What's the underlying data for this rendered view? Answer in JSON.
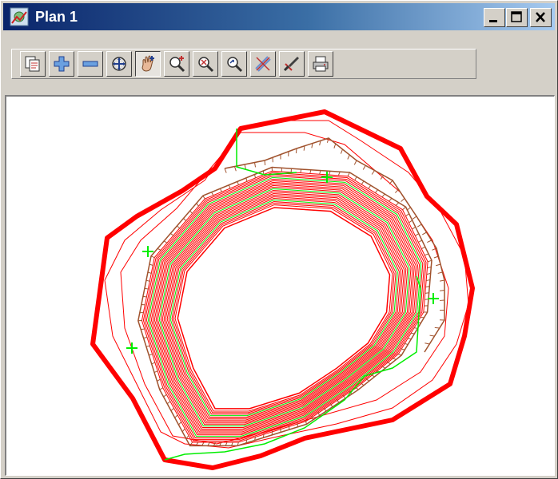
{
  "window": {
    "title": "Plan 1",
    "colors": {
      "titlebar_start": "#0a246a",
      "titlebar_end": "#a6caf0",
      "chrome": "#d4d0c8"
    },
    "controls": [
      "minimize-icon",
      "maximize-icon",
      "close-icon"
    ]
  },
  "toolbar": {
    "buttons": [
      {
        "name": "plan-views-button",
        "icon": "plan-views-icon"
      },
      {
        "name": "zoom-in-button",
        "icon": "plus-icon"
      },
      {
        "name": "zoom-out-button",
        "icon": "minus-icon"
      },
      {
        "name": "pan-button",
        "icon": "pan-arrows-icon"
      },
      {
        "name": "hand-pan-button",
        "icon": "hand-icon",
        "active": true
      },
      {
        "name": "zoom-window-button",
        "icon": "zoom-window-icon"
      },
      {
        "name": "zoom-extent-button",
        "icon": "zoom-extent-icon"
      },
      {
        "name": "zoom-back-button",
        "icon": "zoom-back-icon"
      },
      {
        "name": "clean-button",
        "icon": "clean-icon"
      },
      {
        "name": "pick-button",
        "icon": "pick-icon"
      },
      {
        "name": "print-button",
        "icon": "printer-icon"
      }
    ]
  },
  "plan": {
    "colors": {
      "boundary": "#ff0000",
      "contours": "#ff0000",
      "breaklines": "#00ee00",
      "top_of_batter": "#a0522d"
    },
    "crosshair_markers": 4
  }
}
